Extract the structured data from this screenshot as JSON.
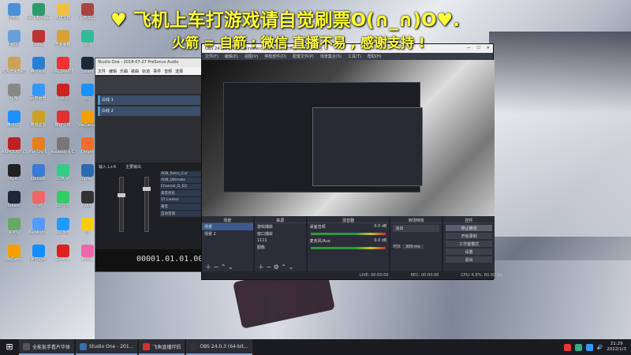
{
  "overlay": {
    "line1": "♥ 飞机上车打游戏请自觉刷票O(∩_∩)O♥.",
    "line2": "火箭 = 自箭 : 微信 直播不易 , 感谢支持 !"
  },
  "desktop_icons": [
    {
      "label": "此电脑",
      "color": "#4a90d9"
    },
    {
      "label": "Cent Browser",
      "color": "#2c9c6a"
    },
    {
      "label": "新建文档",
      "color": "#f0c040"
    },
    {
      "label": "图吧工具",
      "color": "#a44"
    },
    {
      "label": "回收站",
      "color": "#6aa0d8"
    },
    {
      "label": "Dota2",
      "color": "#b33"
    },
    {
      "label": "王者荣耀",
      "color": "#d9a037"
    },
    {
      "label": "360",
      "color": "#3b9"
    },
    {
      "label": "PLAYER BATTLE",
      "color": "#caa25a"
    },
    {
      "label": "腾讯视频",
      "color": "#2a7fd4"
    },
    {
      "label": "VALORANT",
      "color": "#e33"
    },
    {
      "label": "Steam",
      "color": "#1b2838"
    },
    {
      "label": "程序",
      "color": "#888"
    },
    {
      "label": "百度网盘",
      "color": "#39f"
    },
    {
      "label": "网易云",
      "color": "#c22"
    },
    {
      "label": "QQ",
      "color": "#1e90ff"
    },
    {
      "label": "腾讯QQ",
      "color": "#1e90ff"
    },
    {
      "label": "英雄联盟",
      "color": "#c9a227"
    },
    {
      "label": "穿越火线",
      "color": "#d33"
    },
    {
      "label": "WeGame",
      "color": "#f59f00"
    },
    {
      "label": "ARMOURY CRATE",
      "color": "#b22"
    },
    {
      "label": "Far Cry 5",
      "color": "#e67e22"
    },
    {
      "label": "Assassin's Creed",
      "color": "#777"
    },
    {
      "label": "Origin",
      "color": "#f56c2d"
    },
    {
      "label": "Epic",
      "color": "#222"
    },
    {
      "label": "Ubisoft",
      "color": "#3a7bd5"
    },
    {
      "label": "GTA V",
      "color": "#3c8"
    },
    {
      "label": "Uplay",
      "color": "#2b6cb0"
    },
    {
      "label": "Steam",
      "color": "#1b2838"
    },
    {
      "label": "火绒",
      "color": "#e66"
    },
    {
      "label": "QQ音乐",
      "color": "#3c6"
    },
    {
      "label": "OBS",
      "color": "#333"
    },
    {
      "label": "KMS",
      "color": "#6a6"
    },
    {
      "label": "NetAudio",
      "color": "#59f"
    },
    {
      "label": "QQ游戏",
      "color": "#29f"
    },
    {
      "label": "YY",
      "color": "#fc0"
    },
    {
      "label": "WeGame",
      "color": "#f59f00"
    },
    {
      "label": "暴雪战网",
      "color": "#148eff"
    },
    {
      "label": "Garena",
      "color": "#d22"
    },
    {
      "label": "Music",
      "color": "#e6a"
    }
  ],
  "studio_one": {
    "title": "Studio One - 2018-07-27 PreSonus Audio",
    "menu": [
      "文件",
      "编辑",
      "乐曲",
      "歌曲",
      "轨道",
      "事件",
      "音频",
      "选择"
    ],
    "tracks": [
      "白线 1",
      "白线 2"
    ],
    "channels": [
      "输入 L+R",
      "主要输出"
    ],
    "inserts": [
      "AD8_Retro_Cur",
      "AD8_Ultimate",
      "Channel_D_EQ",
      "高音优化",
      "ST Limiter",
      "悬音",
      "自动音调"
    ],
    "time": "00001.01.01.00"
  },
  "obs": {
    "title": "OBS 24.0.3 (64-bit, windows) - 配置文件: 未命名 - 场景: 未命名",
    "menu": [
      "文件(F)",
      "编辑(E)",
      "视图(V)",
      "停靠部件(D)",
      "配置文件(P)",
      "场景集合(S)",
      "工具(T)",
      "帮助(H)"
    ],
    "docks": {
      "scenes": "场景",
      "sources": "来源",
      "mixer": "混音器",
      "transitions": "转场特效",
      "controls": "控件"
    },
    "scenes": [
      "场景",
      "场景 2"
    ],
    "sources": [
      "游戏捕获",
      "窗口捕获",
      "1111",
      "图像"
    ],
    "mixer": [
      {
        "label": "桌面音频",
        "level": "0.0 dB"
      },
      {
        "label": "麦克风/Aux",
        "level": "0.0 dB"
      }
    ],
    "transition": "淡出",
    "duration_label": "时长",
    "duration": "300 ms",
    "controls": [
      "停止推流",
      "开始录制",
      "工作室模式",
      "设置",
      "退出"
    ],
    "status": {
      "live": "LIVE: 00:00:00",
      "rec": "REC: 00:00:00",
      "cpu": "CPU: 6.6%, 60.00 fps"
    }
  },
  "taskbar": {
    "apps": [
      {
        "label": "全能扳手看片华体",
        "color": "#555"
      },
      {
        "label": "Studio One - 201...",
        "color": "#3a6ea5"
      },
      {
        "label": "飞鱼直播伴侣",
        "color": "#c33"
      },
      {
        "label": "OBS 24.0.3 (64-bit...",
        "color": "#333"
      }
    ],
    "time": "21:29",
    "date": "2022/1/3"
  }
}
